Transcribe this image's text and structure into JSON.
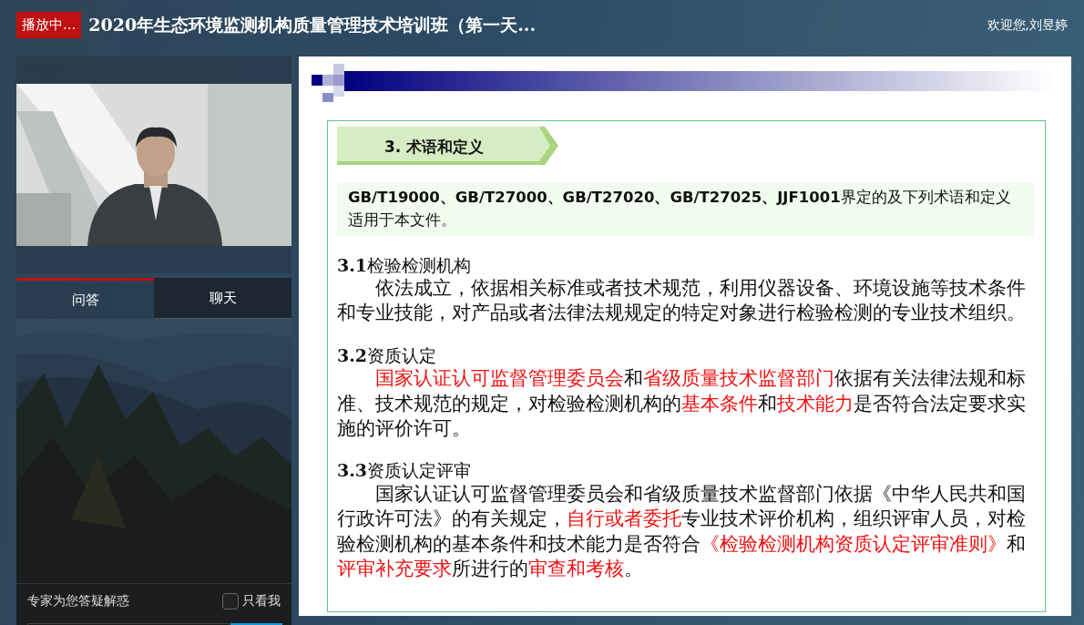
{
  "header": {
    "status_badge": "播放中...",
    "title": "2020年生态环境监测机构质量管理技术培训班（第一天...",
    "welcome": "欢迎您,刘昱婷"
  },
  "tabs": [
    {
      "label": "问答",
      "selected": true
    },
    {
      "label": "聊天",
      "selected": false
    }
  ],
  "qa_footer": {
    "label": "专家为您答疑解惑",
    "only_me": {
      "label": "只看我",
      "checked": false
    }
  },
  "slide": {
    "section_title": "3.  术语和定义",
    "intro": "**GB/T19000、GB/T27000、GB/T27020、GB/T27025、JJF1001**界定的及下列术语和定义适用于本文件。",
    "terms": [
      {
        "heading": "**3.1**检验检测机构",
        "body": [
          {
            "text": "依法成立，依据相关标准或者技术规范，利用仪器设备、环境设施等技术条件和专业技能，对产品或者法律法规规定的特定对象进行检验检测的专业技术组织。",
            "highlight": false
          }
        ]
      },
      {
        "heading": "**3.2**资质认定",
        "body": [
          {
            "text": "国家认证认可监督管理委员会",
            "highlight": true
          },
          {
            "text": "和",
            "highlight": false
          },
          {
            "text": "省级质量技术监督部门",
            "highlight": true
          },
          {
            "text": "依据有关法律法规和标准、技术规范的规定，对检验检测机构的",
            "highlight": false
          },
          {
            "text": "基本条件",
            "highlight": true
          },
          {
            "text": "和",
            "highlight": false
          },
          {
            "text": "技术能力",
            "highlight": true
          },
          {
            "text": "是否符合法定要求实施的评价许可。",
            "highlight": false
          }
        ]
      },
      {
        "heading": "**3.3**资质认定评审",
        "body": [
          {
            "text": "国家认证认可监督管理委员会和省级质量技术监督部门依据《中华人民共和国行政许可法》的有关规定，",
            "highlight": false
          },
          {
            "text": "自行或者委托",
            "highlight": true
          },
          {
            "text": "专业技术评价机构，组织评审人员，对检验检测机构的基本条件和技术能力是否符合",
            "highlight": false
          },
          {
            "text": "《检验检测机构资质认定评审准则》",
            "highlight": true
          },
          {
            "text": "和",
            "highlight": false
          },
          {
            "text": "评审补充要求",
            "highlight": true
          },
          {
            "text": "所进行的",
            "highlight": false
          },
          {
            "text": "审查和考核",
            "highlight": true
          },
          {
            "text": "。",
            "highlight": false
          }
        ]
      }
    ]
  }
}
